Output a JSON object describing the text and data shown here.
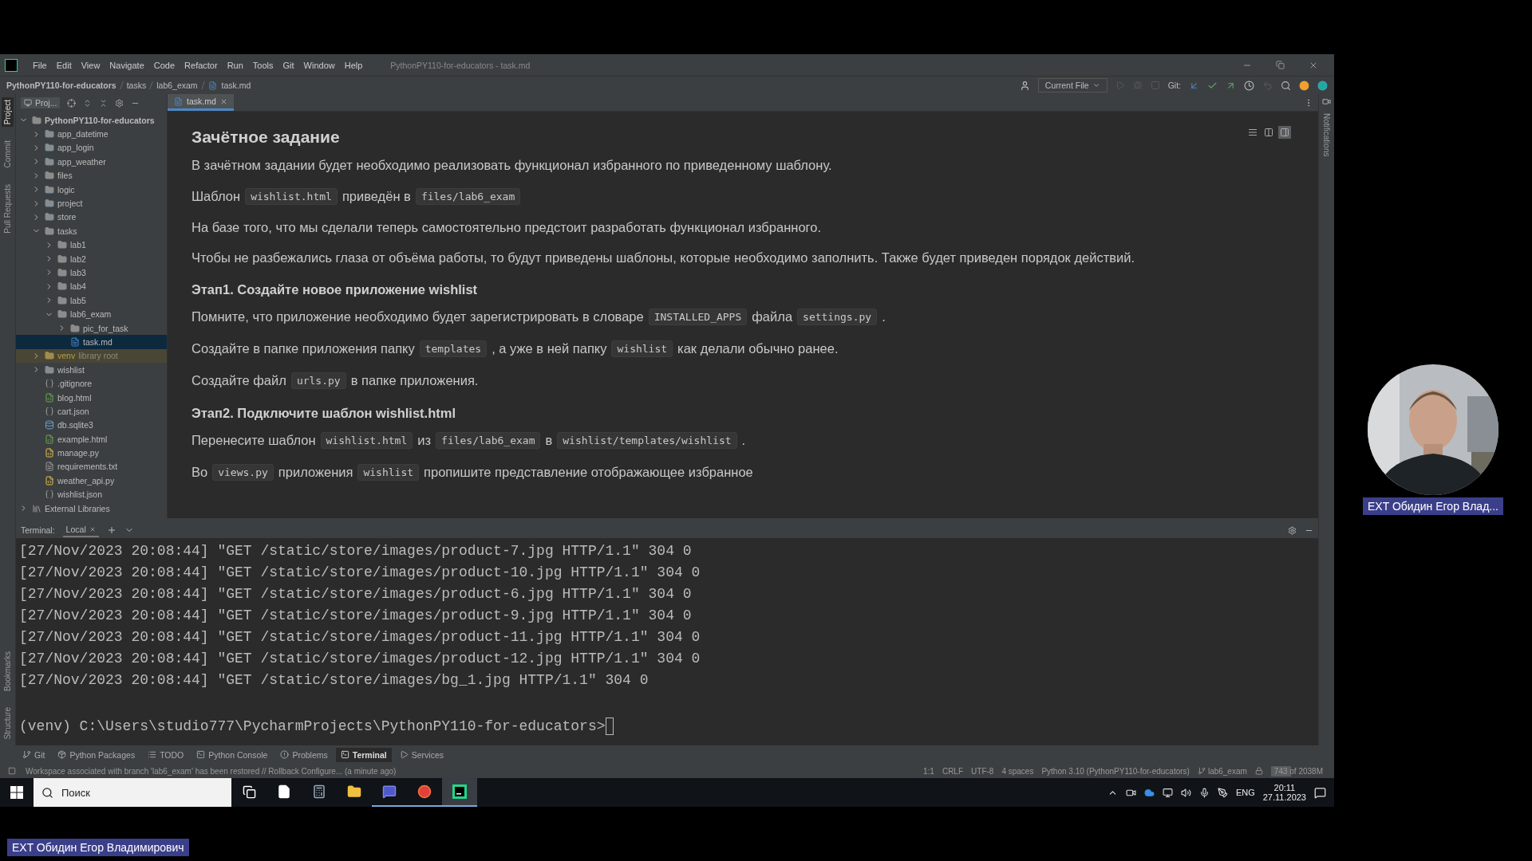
{
  "window": {
    "title": "PythonPY110-for-educators - task.md",
    "menu": [
      "File",
      "Edit",
      "View",
      "Navigate",
      "Code",
      "Refactor",
      "Run",
      "Tools",
      "Git",
      "Window",
      "Help"
    ]
  },
  "breadcrumbs": [
    "PythonPY110-for-educators",
    "tasks",
    "lab6_exam",
    "task.md"
  ],
  "toolbar": {
    "run_config": "Current File",
    "git_label": "Git:"
  },
  "left_strip": [
    {
      "label": "Project",
      "selected": true
    },
    {
      "label": "Commit",
      "selected": false
    },
    {
      "label": "Pull Requests",
      "selected": false
    }
  ],
  "left_strip_bottom": [
    {
      "label": "Bookmarks",
      "selected": false
    },
    {
      "label": "Structure",
      "selected": false
    }
  ],
  "right_strip": [
    "Notifications"
  ],
  "project_panel": {
    "title": "Proj..."
  },
  "tree": [
    {
      "label": "PythonPY110-for-educators",
      "kind": "folder",
      "expanded": true,
      "selected": false,
      "children": [
        {
          "label": "app_datetime",
          "kind": "module",
          "expanded": false,
          "selected": false
        },
        {
          "label": "app_login",
          "kind": "module",
          "expanded": false,
          "selected": false
        },
        {
          "label": "app_weather",
          "kind": "module",
          "expanded": false,
          "selected": false
        },
        {
          "label": "files",
          "kind": "folder",
          "expanded": false,
          "selected": false
        },
        {
          "label": "logic",
          "kind": "module",
          "expanded": false,
          "selected": false
        },
        {
          "label": "project",
          "kind": "module",
          "expanded": false,
          "selected": false
        },
        {
          "label": "store",
          "kind": "module",
          "expanded": false,
          "selected": false
        },
        {
          "label": "tasks",
          "kind": "folder",
          "expanded": true,
          "selected": false,
          "children": [
            {
              "label": "lab1",
              "kind": "folder",
              "expanded": false,
              "selected": false
            },
            {
              "label": "lab2",
              "kind": "folder",
              "expanded": false,
              "selected": false
            },
            {
              "label": "lab3",
              "kind": "folder",
              "expanded": false,
              "selected": false
            },
            {
              "label": "lab4",
              "kind": "folder",
              "expanded": false,
              "selected": false
            },
            {
              "label": "lab5",
              "kind": "folder",
              "expanded": false,
              "selected": false
            },
            {
              "label": "lab6_exam",
              "kind": "folder",
              "expanded": true,
              "selected": false,
              "children": [
                {
                  "label": "pic_for_task",
                  "kind": "folder",
                  "expanded": false,
                  "selected": false
                },
                {
                  "label": "task.md",
                  "kind": "md",
                  "selected": true
                }
              ]
            }
          ]
        },
        {
          "label": "venv",
          "note": "library root",
          "kind": "excluded",
          "expanded": false,
          "selected": false
        },
        {
          "label": "wishlist",
          "kind": "module",
          "expanded": false,
          "selected": false
        },
        {
          "label": ".gitignore",
          "kind": "config",
          "selected": false
        },
        {
          "label": "blog.html",
          "kind": "html",
          "selected": false
        },
        {
          "label": "cart.json",
          "kind": "config",
          "selected": false
        },
        {
          "label": "db.sqlite3",
          "kind": "db",
          "selected": false
        },
        {
          "label": "example.html",
          "kind": "html",
          "selected": false
        },
        {
          "label": "manage.py",
          "kind": "py",
          "selected": false
        },
        {
          "label": "requirements.txt",
          "kind": "txt",
          "selected": false
        },
        {
          "label": "weather_api.py",
          "kind": "py",
          "selected": false
        },
        {
          "label": "wishlist.json",
          "kind": "config",
          "selected": false
        }
      ]
    },
    {
      "label": "External Libraries",
      "kind": "library",
      "expanded": false,
      "selected": false
    }
  ],
  "editor_tabs": [
    {
      "label": "task.md",
      "selected": true
    }
  ],
  "view_modes": [
    {
      "kind": "editor",
      "selected": false
    },
    {
      "kind": "split",
      "selected": false
    },
    {
      "kind": "preview",
      "selected": true
    }
  ],
  "document": [
    {
      "kind": "h1",
      "text": "Зачётное задание"
    },
    {
      "kind": "p",
      "parts": [
        {
          "text": "В зачётном задании будет необходимо реализовать функционал избранного по приведенному шаблону.",
          "code": false
        }
      ]
    },
    {
      "kind": "p",
      "parts": [
        {
          "text": "Шаблон",
          "code": false
        },
        {
          "text": "wishlist.html",
          "code": true
        },
        {
          "text": "приведён в",
          "code": false
        },
        {
          "text": "files/lab6_exam",
          "code": true
        }
      ]
    },
    {
      "kind": "p",
      "parts": [
        {
          "text": "На базе того, что мы сделали теперь самостоятельно предстоит разработать функционал избранного.",
          "code": false
        }
      ]
    },
    {
      "kind": "p",
      "parts": [
        {
          "text": "Чтобы не разбежались глаза от объёма работы, то будут приведены шаблоны, которые необходимо заполнить. Также будет приведен порядок действий.",
          "code": false
        }
      ]
    },
    {
      "kind": "h2",
      "text": "Этап1. Создайте новое приложение wishlist"
    },
    {
      "kind": "p",
      "parts": [
        {
          "text": "Помните, что приложение необходимо будет зарегистрировать в словаре",
          "code": false
        },
        {
          "text": "INSTALLED_APPS",
          "code": true
        },
        {
          "text": "файла",
          "code": false
        },
        {
          "text": "settings.py",
          "code": true
        },
        {
          "text": ".",
          "code": false
        }
      ]
    },
    {
      "kind": "p",
      "parts": [
        {
          "text": "Создайте в папке приложения папку",
          "code": false
        },
        {
          "text": "templates",
          "code": true
        },
        {
          "text": ", а уже в ней папку",
          "code": false
        },
        {
          "text": "wishlist",
          "code": true
        },
        {
          "text": "как делали обычно ранее.",
          "code": false
        }
      ]
    },
    {
      "kind": "p",
      "parts": [
        {
          "text": "Создайте файл",
          "code": false
        },
        {
          "text": "urls.py",
          "code": true
        },
        {
          "text": "в папке приложения.",
          "code": false
        }
      ]
    },
    {
      "kind": "h2",
      "text": "Этап2. Подключите шаблон wishlist.html"
    },
    {
      "kind": "p",
      "parts": [
        {
          "text": "Перенесите шаблон",
          "code": false
        },
        {
          "text": "wishlist.html",
          "code": true
        },
        {
          "text": "из",
          "code": false
        },
        {
          "text": "files/lab6_exam",
          "code": true
        },
        {
          "text": "в",
          "code": false
        },
        {
          "text": "wishlist/templates/wishlist",
          "code": true
        },
        {
          "text": ".",
          "code": false
        }
      ]
    },
    {
      "kind": "p",
      "parts": [
        {
          "text": "Во",
          "code": false
        },
        {
          "text": "views.py",
          "code": true
        },
        {
          "text": "приложения",
          "code": false
        },
        {
          "text": "wishlist",
          "code": true
        },
        {
          "text": "пропишите представление отображающее избранное",
          "code": false
        }
      ]
    }
  ],
  "terminal": {
    "label": "Terminal:",
    "tabs": [
      {
        "label": "Local",
        "selected": true
      }
    ],
    "lines": [
      "[27/Nov/2023 20:08:44] \"GET /static/store/images/product-7.jpg HTTP/1.1\" 304 0",
      "[27/Nov/2023 20:08:44] \"GET /static/store/images/product-10.jpg HTTP/1.1\" 304 0",
      "[27/Nov/2023 20:08:44] \"GET /static/store/images/product-6.jpg HTTP/1.1\" 304 0",
      "[27/Nov/2023 20:08:44] \"GET /static/store/images/product-9.jpg HTTP/1.1\" 304 0",
      "[27/Nov/2023 20:08:44] \"GET /static/store/images/product-11.jpg HTTP/1.1\" 304 0",
      "[27/Nov/2023 20:08:44] \"GET /static/store/images/product-12.jpg HTTP/1.1\" 304 0",
      "[27/Nov/2023 20:08:44] \"GET /static/store/images/bg_1.jpg HTTP/1.1\" 304 0"
    ],
    "prompt": "(venv) C:\\Users\\studio777\\PycharmProjects\\PythonPY110-for-educators>"
  },
  "tool_tabs": [
    {
      "label": "Git",
      "kind": "git",
      "selected": false
    },
    {
      "label": "Python Packages",
      "kind": "packages",
      "selected": false
    },
    {
      "label": "TODO",
      "kind": "todo",
      "selected": false
    },
    {
      "label": "Python Console",
      "kind": "console",
      "selected": false
    },
    {
      "label": "Problems",
      "kind": "problems",
      "selected": false
    },
    {
      "label": "Terminal",
      "kind": "terminal",
      "selected": true
    },
    {
      "label": "Services",
      "kind": "services",
      "selected": false
    }
  ],
  "status_bar": {
    "message": "Workspace associated with branch 'lab6_exam' has been restored // Rollback   Configure... (a minute ago)",
    "items": [
      "1:1",
      "CRLF",
      "UTF-8",
      "4 spaces",
      "Python 3.10 (PythonPY110-for-educators)"
    ],
    "branch": "lab6_exam",
    "memory": {
      "text": "743 of 2038M",
      "level": 0.36
    }
  },
  "taskbar": {
    "search_placeholder": "Поиск",
    "apps": [
      {
        "kind": "taskview",
        "running": false,
        "selected": false
      },
      {
        "kind": "file",
        "running": false,
        "selected": false
      },
      {
        "kind": "calculator",
        "running": false,
        "selected": false
      },
      {
        "kind": "explorer",
        "running": false,
        "selected": false
      },
      {
        "kind": "teams",
        "running": true,
        "selected": false
      },
      {
        "kind": "firefox",
        "running": true,
        "selected": false
      },
      {
        "kind": "pycharm",
        "running": true,
        "selected": true
      }
    ],
    "language": "ENG",
    "time": "20:11",
    "date": "27.11.2023"
  },
  "call": {
    "participant_label": "EXT Обидин Егор Влад...",
    "presenter_label": "EXT Обидин Егор Владимирович"
  }
}
